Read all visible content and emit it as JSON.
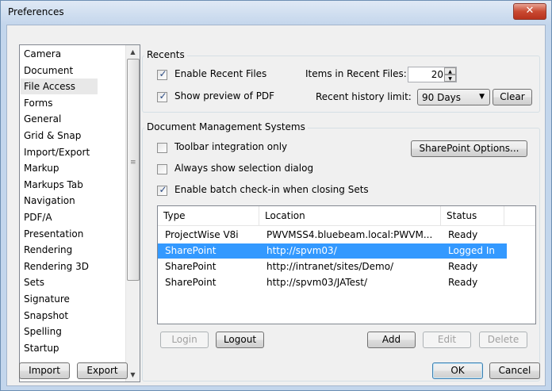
{
  "window": {
    "title": "Preferences",
    "close_glyph": "✕"
  },
  "categories": [
    "Camera",
    "Document",
    "File Access",
    "Forms",
    "General",
    "Grid & Snap",
    "Import/Export",
    "Markup",
    "Markups Tab",
    "Navigation",
    "PDF/A",
    "Presentation",
    "Rendering",
    "Rendering 3D",
    "Sets",
    "Signature",
    "Snapshot",
    "Spelling",
    "Startup"
  ],
  "selected_category": "File Access",
  "left_buttons": {
    "import": "Import",
    "export": "Export"
  },
  "recents": {
    "group_label": "Recents",
    "enable_recent": {
      "label": "Enable Recent Files",
      "checked": true
    },
    "show_preview": {
      "label": "Show preview of PDF",
      "checked": true
    },
    "items_label": "Items in Recent Files:",
    "items_value": "20",
    "history_label": "Recent history limit:",
    "history_value": "90 Days",
    "clear": "Clear"
  },
  "dms": {
    "group_label": "Document Management Systems",
    "toolbar_only": {
      "label": "Toolbar integration only",
      "checked": false
    },
    "always_show": {
      "label": "Always show selection dialog",
      "checked": false
    },
    "batch_checkin": {
      "label": "Enable batch check-in when closing Sets",
      "checked": true
    },
    "sharepoint_options": "SharePoint Options...",
    "columns": [
      "Type",
      "Location",
      "Status"
    ],
    "rows": [
      {
        "type": "ProjectWise V8i",
        "location": "PWVMSS4.bluebeam.local:PWVM...",
        "status": "Ready",
        "selected": false
      },
      {
        "type": "SharePoint",
        "location": "http://spvm03/",
        "status": "Logged In",
        "selected": true
      },
      {
        "type": "SharePoint",
        "location": "http://intranet/sites/Demo/",
        "status": "Ready",
        "selected": false
      },
      {
        "type": "SharePoint",
        "location": "http://spvm03/JATest/",
        "status": "Ready",
        "selected": false
      }
    ],
    "buttons": {
      "login": "Login",
      "logout": "Logout",
      "add": "Add",
      "edit": "Edit",
      "delete": "Delete"
    }
  },
  "footer": {
    "ok": "OK",
    "cancel": "Cancel"
  },
  "colors": {
    "selection": "#3399ff",
    "title_bar": "#c4d6ec",
    "close": "#c94a32"
  }
}
